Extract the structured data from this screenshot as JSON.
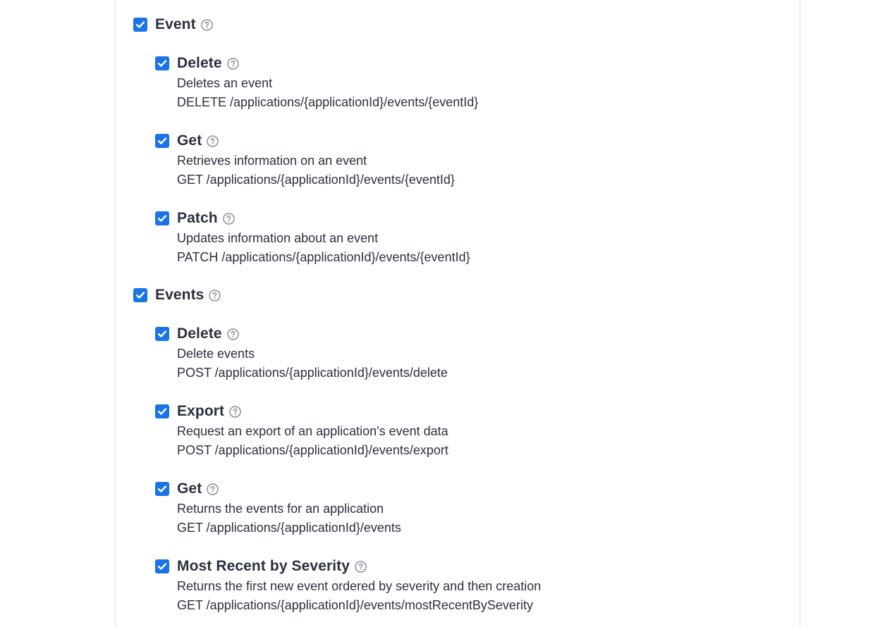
{
  "groups": [
    {
      "title": "Event",
      "checked": true,
      "items": [
        {
          "title": "Delete",
          "checked": true,
          "description": "Deletes an event",
          "endpoint": "DELETE /applications/{applicationId}/events/{eventId}"
        },
        {
          "title": "Get",
          "checked": true,
          "description": "Retrieves information on an event",
          "endpoint": "GET /applications/{applicationId}/events/{eventId}"
        },
        {
          "title": "Patch",
          "checked": true,
          "description": "Updates information about an event",
          "endpoint": "PATCH /applications/{applicationId}/events/{eventId}"
        }
      ]
    },
    {
      "title": "Events",
      "checked": true,
      "items": [
        {
          "title": "Delete",
          "checked": true,
          "description": "Delete events",
          "endpoint": "POST /applications/{applicationId}/events/delete"
        },
        {
          "title": "Export",
          "checked": true,
          "description": "Request an export of an application's event data",
          "endpoint": "POST /applications/{applicationId}/events/export"
        },
        {
          "title": "Get",
          "checked": true,
          "description": "Returns the events for an application",
          "endpoint": "GET /applications/{applicationId}/events"
        },
        {
          "title": "Most Recent by Severity",
          "checked": true,
          "description": "Returns the first new event ordered by severity and then creation",
          "endpoint": "GET /applications/{applicationId}/events/mostRecentBySeverity"
        }
      ]
    }
  ],
  "colors": {
    "checkbox": "#1a73e8",
    "text": "#2b3040",
    "border": "#dcdfe4",
    "help_icon": "#8a8f99"
  },
  "icons": {
    "checkbox": "check-icon",
    "help": "question-circle-icon"
  }
}
